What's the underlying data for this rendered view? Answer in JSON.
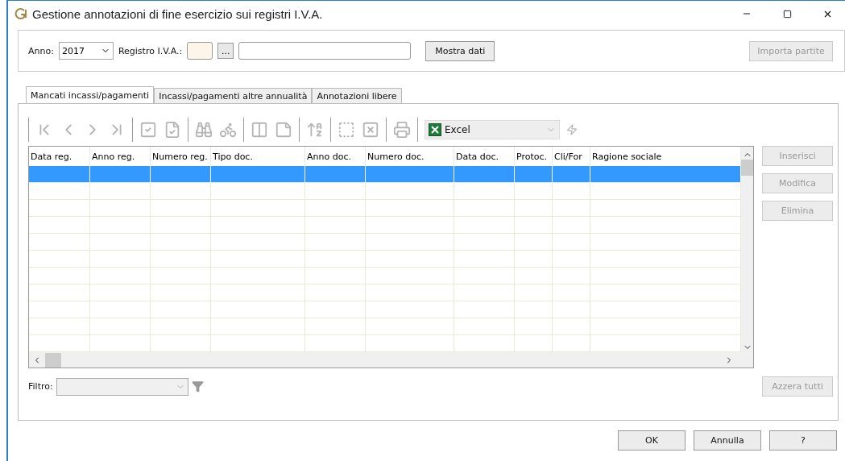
{
  "window": {
    "title": "Gestione annotazioni di fine esercizio sui registri I.V.A."
  },
  "header": {
    "year_label": "Anno:",
    "year": "2017",
    "register_label": "Registro I.V.A.:",
    "browse": "...",
    "show_button": {
      "label": "Mostra dati",
      "disabled": false
    },
    "import_button": {
      "label": "Importa partite",
      "disabled": true
    }
  },
  "tabs": [
    {
      "label": "Mancati incassi/pagamenti",
      "selected": true
    },
    {
      "label": "Incassi/pagamenti altre annualità",
      "selected": false
    },
    {
      "label": "Annotazioni libere",
      "selected": false
    }
  ],
  "toolbar": {
    "export_format": "Excel"
  },
  "table": {
    "columns": [
      "Data reg.",
      "Anno reg.",
      "Numero reg.",
      "Tipo doc.",
      "Anno doc.",
      "Numero doc.",
      "Data doc.",
      "Protoc.",
      "Cli/For",
      "Ragione sociale"
    ],
    "rows": [
      {
        "selected": true
      },
      {
        "selected": false
      },
      {
        "selected": false
      },
      {
        "selected": false
      },
      {
        "selected": false
      },
      {
        "selected": false
      },
      {
        "selected": false
      },
      {
        "selected": false
      },
      {
        "selected": false
      },
      {
        "selected": false
      },
      {
        "selected": false
      }
    ]
  },
  "side_buttons": [
    {
      "label": "Inserisci",
      "disabled": true
    },
    {
      "label": "Modifica",
      "disabled": true
    },
    {
      "label": "Elimina",
      "disabled": true
    }
  ],
  "filter": {
    "label": "Filtro:",
    "reset_button": {
      "label": "Azzera tutti",
      "disabled": true
    }
  },
  "footer_buttons": [
    {
      "label": "OK",
      "disabled": false
    },
    {
      "label": "Annulla",
      "disabled": false
    },
    {
      "label": "?",
      "disabled": false
    }
  ]
}
